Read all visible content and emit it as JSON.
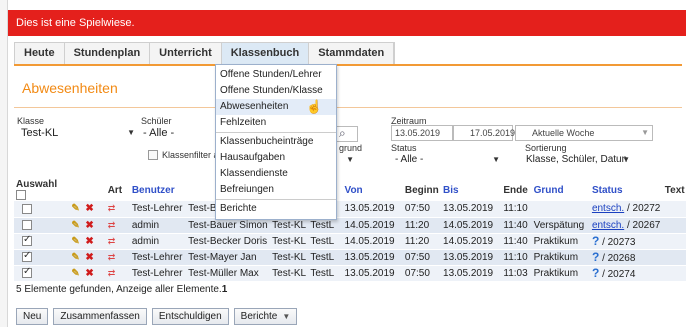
{
  "banner": "Dies ist eine Spielwiese.",
  "nav": [
    "Heute",
    "Stundenplan",
    "Unterricht",
    "Klassenbuch",
    "Stammdaten"
  ],
  "page_title": "Abwesenheiten",
  "filters": {
    "klasse_label": "Klasse",
    "klasse_value": "Test-KL",
    "schueler_label": "Schüler",
    "schueler_value": "- Alle -",
    "klassenfilter": "Klassenfilter ak",
    "grund_label": "grund",
    "status_label": "Status",
    "status_value": "- Alle -",
    "zeitraum_label": "Zeitraum",
    "date_from": "13.05.2019",
    "date_to": "17.05.2019",
    "zeitraum_value": "Aktuelle Woche",
    "sortierung_label": "Sortierung",
    "sortierung_value": "Klasse, Schüler, Datun"
  },
  "table": {
    "headers": {
      "auswahl": "Auswahl",
      "art": "Art",
      "benutzer": "Benutzer",
      "leh": "Leh",
      "von": "Von",
      "beginn": "Beginn",
      "bis": "Bis",
      "ende": "Ende",
      "grund": "Grund",
      "status": "Status",
      "text": "Text"
    },
    "rows": [
      {
        "checked": false,
        "benutzer": "Test-Lehrer",
        "schueler": "Test-Bauer Simon",
        "klasse": "Test-KL",
        "lehrer": "TestL",
        "von": "13.05.2019",
        "beginn": "07:50",
        "bis": "13.05.2019",
        "ende": "11:10",
        "grund": "",
        "status_link": "entsch.",
        "status_num": "/ 20272",
        "status_icon": ""
      },
      {
        "checked": false,
        "benutzer": "admin",
        "schueler": "Test-Bauer Simon",
        "klasse": "Test-KL",
        "lehrer": "TestL",
        "von": "14.05.2019",
        "beginn": "11:20",
        "bis": "14.05.2019",
        "ende": "11:40",
        "grund": "Verspätung",
        "status_link": "entsch.",
        "status_num": "/ 20267",
        "status_icon": ""
      },
      {
        "checked": true,
        "benutzer": "admin",
        "schueler": "Test-Becker Doris",
        "klasse": "Test-KL",
        "lehrer": "TestL",
        "von": "14.05.2019",
        "beginn": "11:20",
        "bis": "14.05.2019",
        "ende": "11:40",
        "grund": "Praktikum",
        "status_link": "",
        "status_num": "/ 20273",
        "status_icon": "?"
      },
      {
        "checked": true,
        "benutzer": "Test-Lehrer",
        "schueler": "Test-Mayer Jan",
        "klasse": "Test-KL",
        "lehrer": "TestL",
        "von": "13.05.2019",
        "beginn": "07:50",
        "bis": "13.05.2019",
        "ende": "11:10",
        "grund": "Praktikum",
        "status_link": "",
        "status_num": "/ 20268",
        "status_icon": "?"
      },
      {
        "checked": true,
        "benutzer": "Test-Lehrer",
        "schueler": "Test-Müller Max",
        "klasse": "Test-KL",
        "lehrer": "TestL",
        "von": "13.05.2019",
        "beginn": "07:50",
        "bis": "13.05.2019",
        "ende": "11:03",
        "grund": "Praktikum",
        "status_link": "",
        "status_num": "/ 20274",
        "status_icon": "?"
      }
    ]
  },
  "footer_text": "5 Elemente gefunden, Anzeige aller Elemente.",
  "footer_page": "1",
  "buttons": [
    "Neu",
    "Zusammenfassen",
    "Entschuldigen",
    "Berichte"
  ],
  "menu": [
    "Offene Stunden/Lehrer",
    "Offene Stunden/Klasse",
    "Abwesenheiten",
    "Fehlzeiten",
    "Klassenbucheinträge",
    "Hausaufgaben",
    "Klassendienste",
    "Befreiungen",
    "Berichte"
  ],
  "colors": {
    "banner": "#e4201c",
    "title": "#f28a14",
    "link": "#1a40c0"
  }
}
